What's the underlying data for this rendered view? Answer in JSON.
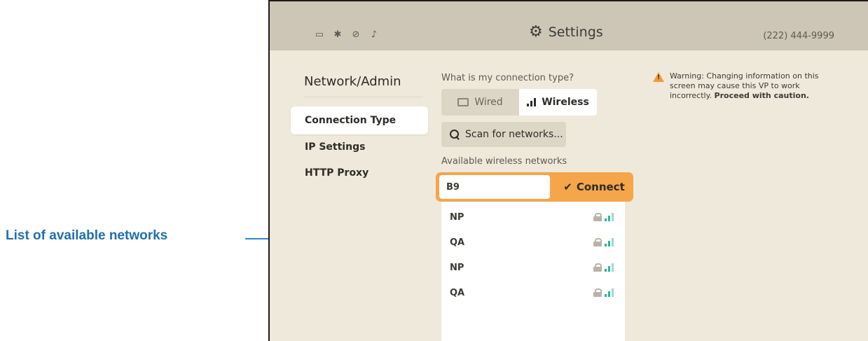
{
  "callout": {
    "label": "List of available networks",
    "color": "#1f6fb0"
  },
  "topbar": {
    "status_icons": [
      "ethernet-icon",
      "bluetooth-icon",
      "camera-off-icon",
      "mic-off-icon"
    ],
    "title": "Settings",
    "title_icon": "gear-icon",
    "phone": "(222) 444-9999"
  },
  "sidebar": {
    "heading": "Network/Admin",
    "items": [
      {
        "label": "Connection Type",
        "active": true
      },
      {
        "label": "IP Settings",
        "active": false
      },
      {
        "label": "HTTP Proxy",
        "active": false
      }
    ]
  },
  "connection": {
    "question": "What is my connection type?",
    "options": [
      {
        "label": "Wired",
        "selected": false
      },
      {
        "label": "Wireless",
        "selected": true
      }
    ]
  },
  "scan_button": {
    "label": "Scan for networks..."
  },
  "networks": {
    "label": "Available wireless networks",
    "selected": {
      "name": "B9",
      "action": "Connect"
    },
    "items": [
      {
        "name": "NP",
        "locked": true
      },
      {
        "name": "QA",
        "locked": true
      },
      {
        "name": "NP",
        "locked": true
      },
      {
        "name": "QA",
        "locked": true
      }
    ]
  },
  "warning": {
    "text": "Warning: Changing information on this screen may cause this VP to work incorrectly.",
    "emphasis": "Proceed with caution."
  },
  "colors": {
    "accent": "#f5a64a",
    "signal": "#2bb3a3",
    "background": "#efe9db",
    "topbar": "#cdc6b6"
  }
}
